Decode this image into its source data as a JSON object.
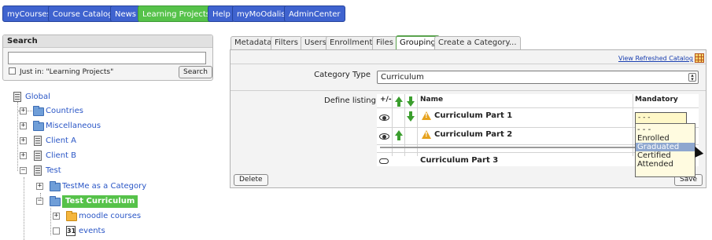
{
  "nav": {
    "items": [
      {
        "label": "myCourses"
      },
      {
        "label": "Course Catalog"
      },
      {
        "label": "News"
      },
      {
        "label": "Learning Projects",
        "active": true
      },
      {
        "label": "Help"
      },
      {
        "label": "myMoOdalis"
      },
      {
        "label": "AdminCenter"
      }
    ],
    "colors": {
      "default": "#3f63cf",
      "active": "#56c24a"
    }
  },
  "search": {
    "title": "Search",
    "input_value": "",
    "checkbox_label": "Just in: \"Learning Projects\"",
    "button_label": "Search"
  },
  "tree": {
    "root": "Global",
    "nodes": [
      {
        "label": "Countries",
        "icon": "folder-icon"
      },
      {
        "label": "Miscellaneous",
        "icon": "folder-icon"
      },
      {
        "label": "Client A",
        "icon": "document-icon"
      },
      {
        "label": "Client B",
        "icon": "document-icon"
      },
      {
        "label": "Test",
        "icon": "document-icon"
      },
      {
        "label": "TestMe as a Category",
        "icon": "folder-icon"
      },
      {
        "label": "Test Curriculum",
        "icon": "folder-icon",
        "selected": true
      },
      {
        "label": "moodle courses",
        "icon": "folder-orange-icon"
      },
      {
        "label": "events",
        "icon": "event-icon"
      }
    ]
  },
  "tabs": [
    "Metadata",
    "Filters",
    "Users",
    "Enrollment",
    "Files",
    "Grouping",
    "Create a Category..."
  ],
  "active_tab": "Grouping",
  "panel": {
    "view_refreshed": "View Refreshed Catalog",
    "category_type_label": "Category Type",
    "category_type_value": "Curriculum",
    "define_listing_label": "Define listing",
    "columns": {
      "plusminus": "+/-",
      "name": "Name",
      "mandatory": "Mandatory"
    },
    "items": [
      {
        "name": "Curriculum Part 1",
        "mandatory": "- - -"
      },
      {
        "name": "Curriculum Part 2"
      },
      {
        "name": "Curriculum Part 3"
      }
    ],
    "mandatory_options": [
      "- - -",
      "Enrolled",
      "Graduated",
      "Certified",
      "Attended"
    ],
    "highlighted_option": "Graduated",
    "delete_label": "Delete",
    "save_label": "Save"
  }
}
